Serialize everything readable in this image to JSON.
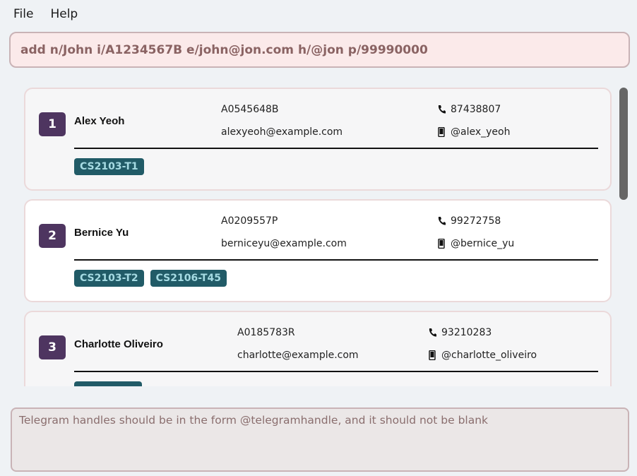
{
  "menu": {
    "file": "File",
    "help": "Help"
  },
  "command": {
    "value": "add n/John i/A1234567B e/john@jon.com h/@jon p/99990000"
  },
  "persons": [
    {
      "index": "1",
      "name": "Alex Yeoh",
      "id": "A0545648B",
      "email": "alexyeoh@example.com",
      "phone": "87438807",
      "telegram": "@alex_yeoh",
      "tags": [
        "CS2103-T1"
      ]
    },
    {
      "index": "2",
      "name": "Bernice Yu",
      "id": "A0209557P",
      "email": "berniceyu@example.com",
      "phone": "99272758",
      "telegram": "@bernice_yu",
      "tags": [
        "CS2103-T2",
        "CS2106-T45"
      ]
    },
    {
      "index": "3",
      "name": "Charlotte Oliveiro",
      "id": "A0185783R",
      "email": "charlotte@example.com",
      "phone": "93210283",
      "telegram": "@charlotte_oliveiro",
      "tags": [
        ""
      ]
    }
  ],
  "result": {
    "message": "Telegram handles should be in the form @telegramhandle, and it should not be blank"
  },
  "colors": {
    "index_badge": "#4e3560",
    "tag_bg": "#215b67",
    "tag_text": "#a6dbe3",
    "command_text": "#8a6363"
  }
}
